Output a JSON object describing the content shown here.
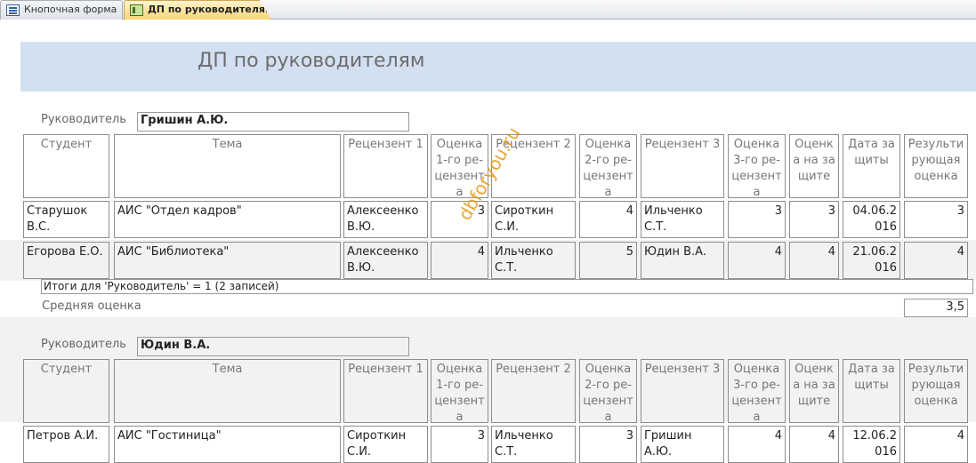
{
  "tabs": [
    {
      "label": "Кнопочная форма",
      "active": false
    },
    {
      "label": "ДП по руководителям",
      "active": true
    }
  ],
  "report": {
    "title": "ДП по руководителям"
  },
  "columns": [
    "Студент",
    "Тема",
    "Рецензент 1",
    "Оценка 1-го ре-цензента",
    "Рецензент 2",
    "Оценка 2-го ре-цензента",
    "Рецензент 3",
    "Оценка 3-го ре-цензента",
    "Оценка на защите",
    "Дата защиты",
    "Результирующая оценка"
  ],
  "groups": [
    {
      "supervisor_label": "Руководитель",
      "supervisor": "Гришин А.Ю.",
      "rows": [
        [
          "Старушок В.С.",
          "АИС \"Отдел кадров\"",
          "Алексеенко В.Ю.",
          "3",
          "Сироткин С.И.",
          "4",
          "Ильченко С.Т.",
          "3",
          "3",
          "04.06.2016",
          "3"
        ],
        [
          "Егорова Е.О.",
          "АИС \"Библиотека\"",
          "Алексеенко В.Ю.",
          "4",
          "Ильченко С.Т.",
          "5",
          "Юдин В.А.",
          "4",
          "4",
          "21.06.2016",
          "4"
        ]
      ],
      "totals_text": "Итоги для 'Руководитель' = 1 (2 записей)",
      "avg_label": "Средняя оценка",
      "avg_value": "3,5"
    },
    {
      "supervisor_label": "Руководитель",
      "supervisor": "Юдин В.А.",
      "rows": [
        [
          "Петров А.И.",
          "АИС \"Гостиница\"",
          "Сироткин С.И.",
          "3",
          "Ильченко С.Т.",
          "3",
          "Гришин А.Ю.",
          "4",
          "4",
          "12.06.2016",
          "4"
        ]
      ]
    }
  ],
  "watermark": "dbforyou.ru",
  "colors": {
    "header_band": "#d3e0f1",
    "active_tab": "#f7d578",
    "alt_row": "#f2f2f2"
  }
}
